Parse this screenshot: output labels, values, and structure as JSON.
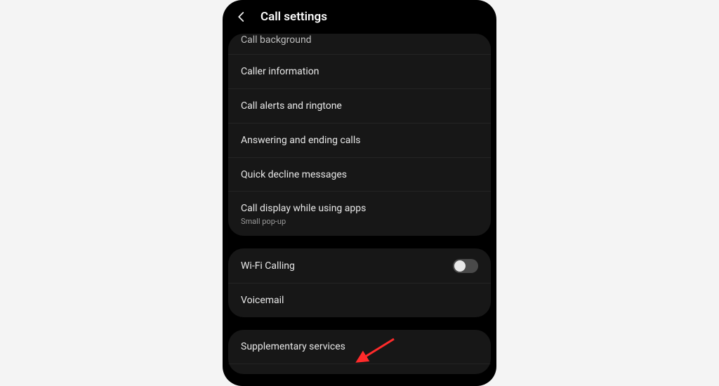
{
  "header": {
    "title": "Call settings"
  },
  "group1": {
    "call_background": "Call background",
    "caller_info": "Caller information",
    "call_alerts": "Call alerts and ringtone",
    "answer_end": "Answering and ending calls",
    "quick_decline": "Quick decline messages",
    "call_display": "Call display while using apps",
    "call_display_sub": "Small pop-up"
  },
  "group2": {
    "wifi_calling": "Wi-Fi Calling",
    "voicemail": "Voicemail"
  },
  "group3": {
    "supplementary": "Supplementary services"
  }
}
